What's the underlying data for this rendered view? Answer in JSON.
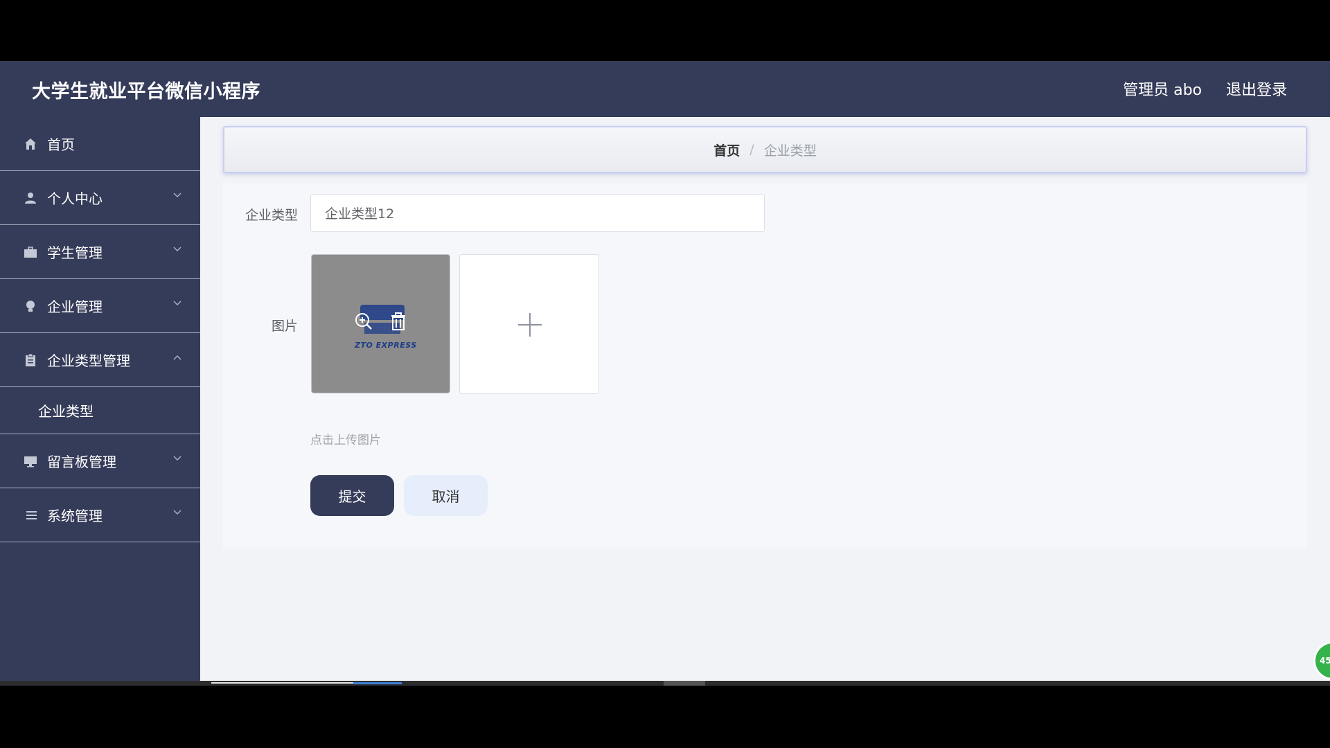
{
  "header": {
    "app_title": "大学生就业平台微信小程序",
    "user_label": "管理员 abo",
    "logout_label": "退出登录"
  },
  "sidebar": {
    "items": [
      {
        "label": "首页",
        "icon": "home-icon"
      },
      {
        "label": "个人中心",
        "icon": "user-icon"
      },
      {
        "label": "学生管理",
        "icon": "briefcase-icon"
      },
      {
        "label": "企业管理",
        "icon": "bulb-icon"
      },
      {
        "label": "企业类型管理",
        "icon": "clipboard-icon",
        "expanded": true,
        "children": [
          {
            "label": "企业类型"
          }
        ]
      },
      {
        "label": "留言板管理",
        "icon": "monitor-icon"
      },
      {
        "label": "系统管理",
        "icon": "list-icon"
      }
    ]
  },
  "breadcrumb": {
    "home": "首页",
    "separator": "/",
    "current": "企业类型"
  },
  "form": {
    "type_label": "企业类型",
    "type_value": "企业类型12",
    "image_label": "图片",
    "image_logo_text": "ZTO EXPRESS",
    "upload_hint": "点击上传图片",
    "submit_label": "提交",
    "cancel_label": "取消"
  },
  "badge": {
    "text": "45"
  },
  "colors": {
    "primary": "#353c59",
    "cancel_bg": "#e6eefb",
    "badge": "#34b34a"
  }
}
